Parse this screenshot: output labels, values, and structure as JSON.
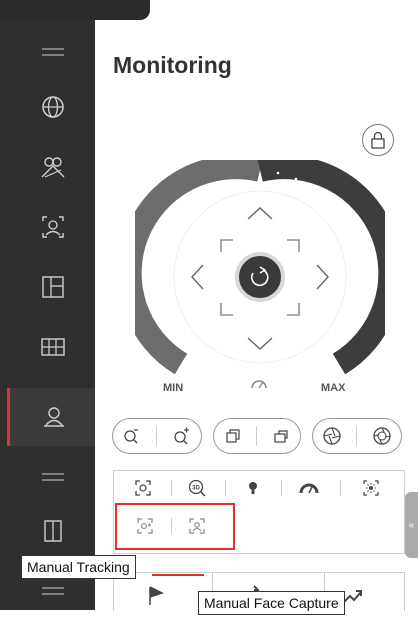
{
  "page": {
    "title": "Monitoring"
  },
  "sidebar": {
    "items": [
      {
        "icon": "menu-icon"
      },
      {
        "icon": "globe-icon"
      },
      {
        "icon": "people-icon"
      },
      {
        "icon": "face-frame-icon"
      },
      {
        "icon": "layout-icon"
      },
      {
        "icon": "grid-icon"
      },
      {
        "icon": "user-icon",
        "active": true
      },
      {
        "icon": "menu-icon"
      },
      {
        "icon": "split-view-icon"
      }
    ]
  },
  "ptz": {
    "min_label": "MIN",
    "max_label": "MAX",
    "center_icon": "refresh-icon",
    "speed_icon": "speedometer-icon"
  },
  "pills": [
    {
      "icons": [
        "zoom-out-icon",
        "zoom-in-icon"
      ]
    },
    {
      "icons": [
        "focus-near-icon",
        "focus-far-icon"
      ]
    },
    {
      "icons": [
        "iris-close-icon",
        "iris-open-icon"
      ]
    }
  ],
  "tools_row1": [
    "auto-focus-icon",
    "3d-zoom-icon",
    "light-icon",
    "wiper-icon",
    "lens-init-icon"
  ],
  "tools_row2": [
    "manual-tracking-icon",
    "manual-face-capture-icon"
  ],
  "tooltips": {
    "manual_tracking": "Manual Tracking",
    "manual_face_capture": "Manual Face Capture"
  },
  "colors": {
    "accent": "#e0312c",
    "sidebar": "#2f2f2f",
    "dial": "#3d3d3d"
  }
}
